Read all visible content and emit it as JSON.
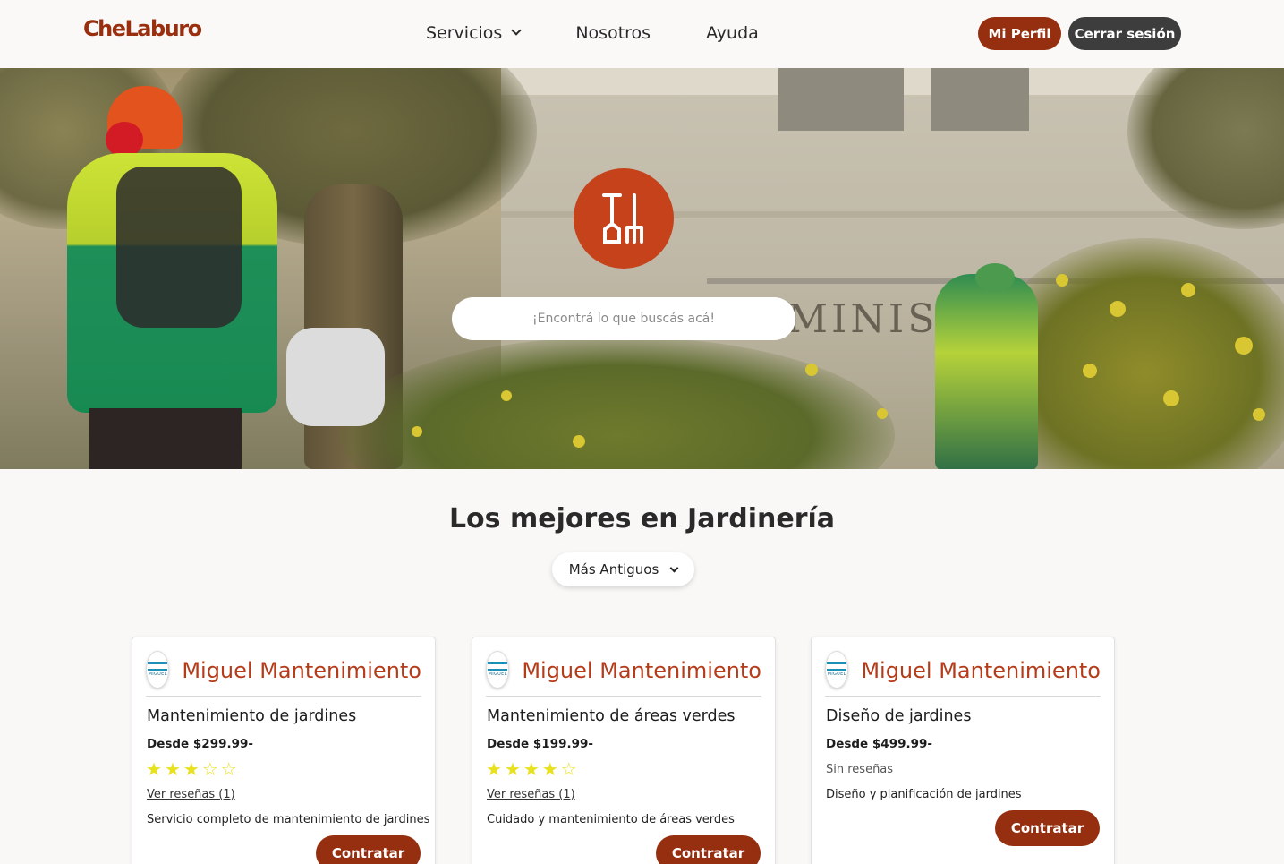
{
  "brand": {
    "logo_text": "CheLaburo"
  },
  "nav": {
    "items": [
      {
        "label": "Servicios"
      },
      {
        "label": "Nosotros"
      },
      {
        "label": "Ayuda"
      }
    ],
    "profile_button": "Mi Perfil",
    "logout_button": "Cerrar sesión"
  },
  "hero": {
    "category_icon": "garden-tools-icon",
    "search_placeholder": "¡Encontrá lo que buscás acá!"
  },
  "section": {
    "title": "Los mejores en Jardinería",
    "sort_selected": "Más Antiguos"
  },
  "cards": [
    {
      "provider": "Miguel Mantenimiento",
      "service": "Mantenimiento de jardines",
      "price": "Desde $299.99-",
      "rating": 3,
      "reviews_label": "Ver reseñas (1)",
      "description": "Servicio completo de mantenimiento de jardines",
      "cta": "Contratar"
    },
    {
      "provider": "Miguel Mantenimiento",
      "service": "Mantenimiento de áreas verdes",
      "price": "Desde $199.99-",
      "rating": 4,
      "reviews_label": "Ver reseñas (1)",
      "description": "Cuidado y mantenimiento de áreas verdes",
      "cta": "Contratar"
    },
    {
      "provider": "Miguel Mantenimiento",
      "service": "Diseño de jardines",
      "price": "Desde $499.99-",
      "rating": null,
      "no_reviews_label": "Sin reseñas",
      "description": "Diseño y planificación de jardines",
      "cta": "Contratar"
    }
  ],
  "colors": {
    "brand": "#952f0f",
    "accent": "#c5421b",
    "provider_name": "#b53c1a",
    "logout": "#3d3d3d",
    "stars": "#e8e11e"
  }
}
